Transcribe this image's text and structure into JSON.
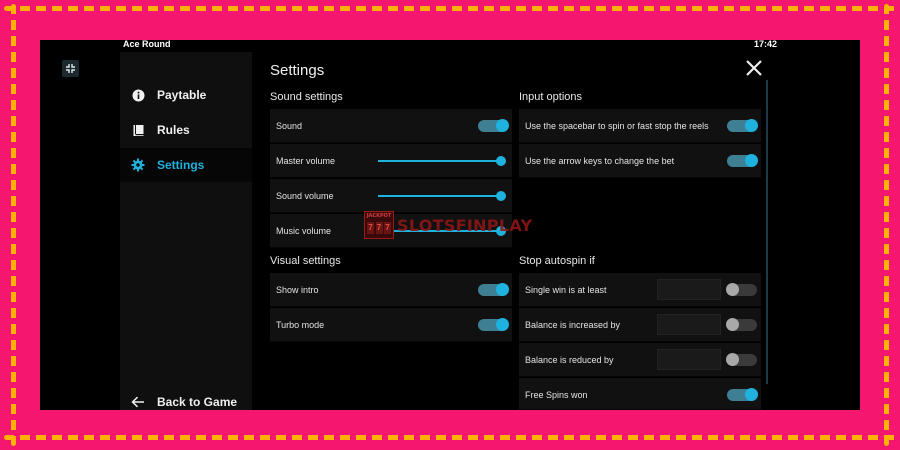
{
  "window": {
    "title": "Ace Round",
    "time": "17:42"
  },
  "sidebar": {
    "items": [
      {
        "label": "Paytable",
        "icon": "info-icon",
        "active": false
      },
      {
        "label": "Rules",
        "icon": "book-icon",
        "active": false
      },
      {
        "label": "Settings",
        "icon": "gear-icon",
        "active": true
      }
    ],
    "back_label": "Back to Game"
  },
  "settings": {
    "title": "Settings",
    "sound": {
      "title": "Sound settings",
      "sound_label": "Sound",
      "sound_on": true,
      "master_label": "Master volume",
      "master_value": 1.0,
      "sound_volume_label": "Sound volume",
      "sound_volume_value": 1.0,
      "music_label": "Music volume",
      "music_value": 1.0
    },
    "visual": {
      "title": "Visual settings",
      "intro_label": "Show intro",
      "intro_on": true,
      "turbo_label": "Turbo mode",
      "turbo_on": true
    },
    "input": {
      "title": "Input options",
      "spacebar_label": "Use the spacebar to spin or fast stop the reels",
      "spacebar_on": true,
      "arrow_label": "Use the arrow keys to change the bet",
      "arrow_on": true
    },
    "autospin": {
      "title": "Stop autospin if",
      "single_win_label": "Single win is at least",
      "single_win_value": "",
      "single_win_on": false,
      "increased_label": "Balance is increased by",
      "increased_value": "",
      "increased_on": false,
      "reduced_label": "Balance is reduced by",
      "reduced_value": "",
      "reduced_on": false,
      "free_spins_label": "Free Spins won",
      "free_spins_on": true
    }
  },
  "watermark": {
    "caption": "JACKPOT",
    "reels": "777",
    "text": "SLOTSFINPLAY"
  },
  "colors": {
    "accent": "#1fb2de",
    "frame": "#f5166f",
    "dashes": "#ffb300"
  }
}
